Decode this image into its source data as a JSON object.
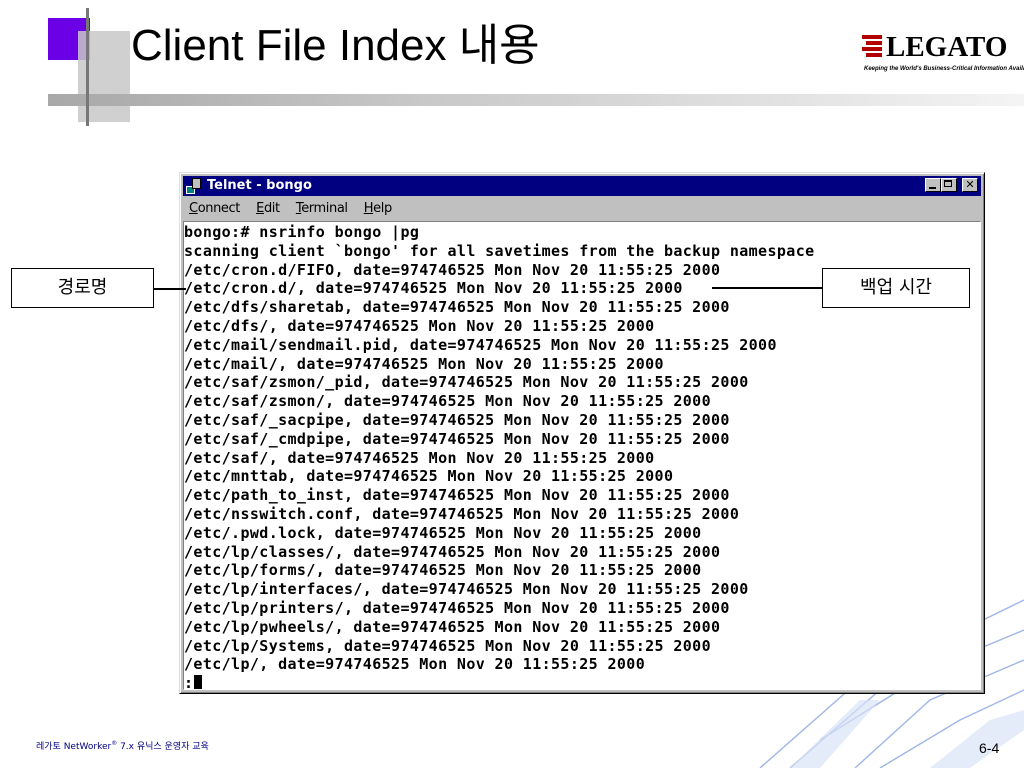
{
  "slide": {
    "title": "Client File Index 내용",
    "page_number": "6-4",
    "footer": {
      "prefix": "레가토 NetWorker",
      "reg_mark": "®",
      "suffix": " 7.x 유닉스 운영자 교육"
    }
  },
  "logo": {
    "name": "LEGATO",
    "tagline": "Keeping the World's Business-Critical Information Available"
  },
  "window": {
    "title": "Telnet - bongo",
    "menu": [
      {
        "accel": "C",
        "rest": "onnect"
      },
      {
        "accel": "E",
        "rest": "dit"
      },
      {
        "accel": "T",
        "rest": "erminal"
      },
      {
        "accel": "H",
        "rest": "elp"
      }
    ],
    "terminal_lines": [
      "bongo:# nsrinfo bongo |pg",
      "scanning client `bongo' for all savetimes from the backup namespace",
      "/etc/cron.d/FIFO, date=974746525 Mon Nov 20 11:55:25 2000",
      "/etc/cron.d/, date=974746525 Mon Nov 20 11:55:25 2000",
      "/etc/dfs/sharetab, date=974746525 Mon Nov 20 11:55:25 2000",
      "/etc/dfs/, date=974746525 Mon Nov 20 11:55:25 2000",
      "/etc/mail/sendmail.pid, date=974746525 Mon Nov 20 11:55:25 2000",
      "/etc/mail/, date=974746525 Mon Nov 20 11:55:25 2000",
      "/etc/saf/zsmon/_pid, date=974746525 Mon Nov 20 11:55:25 2000",
      "/etc/saf/zsmon/, date=974746525 Mon Nov 20 11:55:25 2000",
      "/etc/saf/_sacpipe, date=974746525 Mon Nov 20 11:55:25 2000",
      "/etc/saf/_cmdpipe, date=974746525 Mon Nov 20 11:55:25 2000",
      "/etc/saf/, date=974746525 Mon Nov 20 11:55:25 2000",
      "/etc/mnttab, date=974746525 Mon Nov 20 11:55:25 2000",
      "/etc/path_to_inst, date=974746525 Mon Nov 20 11:55:25 2000",
      "/etc/nsswitch.conf, date=974746525 Mon Nov 20 11:55:25 2000",
      "/etc/.pwd.lock, date=974746525 Mon Nov 20 11:55:25 2000",
      "/etc/lp/classes/, date=974746525 Mon Nov 20 11:55:25 2000",
      "/etc/lp/forms/, date=974746525 Mon Nov 20 11:55:25 2000",
      "/etc/lp/interfaces/, date=974746525 Mon Nov 20 11:55:25 2000",
      "/etc/lp/printers/, date=974746525 Mon Nov 20 11:55:25 2000",
      "/etc/lp/pwheels/, date=974746525 Mon Nov 20 11:55:25 2000",
      "/etc/lp/Systems, date=974746525 Mon Nov 20 11:55:25 2000",
      "/etc/lp/, date=974746525 Mon Nov 20 11:55:25 2000"
    ],
    "prompt": ":"
  },
  "callouts": {
    "left": "경로명",
    "right": "백업 시간"
  }
}
